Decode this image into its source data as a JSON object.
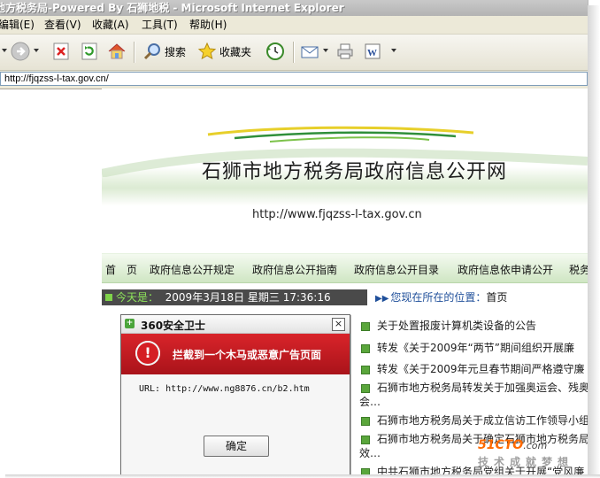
{
  "window": {
    "title": "地方税务局-Powered By 石狮地税 - Microsoft Internet Explorer"
  },
  "menu": {
    "items": [
      "编辑(E)",
      "查看(V)",
      "收藏(A)",
      "工具(T)",
      "帮助(H)"
    ]
  },
  "toolbar": {
    "search_label": "搜索",
    "favorites_label": "收藏夹"
  },
  "address": {
    "url": "http://fjqzss-l-tax.gov.cn/"
  },
  "site": {
    "title": "石狮市地方税务局政府信息公开网",
    "url": "http://www.fjqzss-l-tax.gov.cn"
  },
  "nav": {
    "items": [
      "首　页",
      "政府信息公开规定",
      "政府信息公开指南",
      "政府信息公开目录",
      "政府信息依申请公开",
      "税务"
    ]
  },
  "datebar": {
    "today_label": "今天是：",
    "datetime": "2009年3月18日 星期三 17:36:16",
    "location_label": "您现在所在的位置：",
    "location": "首页"
  },
  "news": {
    "items": [
      "关于处置报废计算机类设备的公告",
      "转发《关于2009年“两节”期间组织开展廉",
      "转发《关于2009年元旦春节期间严格遵守廉",
      "石狮市地方税务局转发关于加强奥运会、残奥",
      "会…",
      "石狮市地方税务局关于成立信访工作领导小组",
      "石狮市地方税务局关于确定石狮市地方税务局",
      "效…",
      "中共石狮市地方税务局党组关于开展“党风廉"
    ]
  },
  "dialog": {
    "title": "360安全卫士",
    "close": "×",
    "message": "拦截到一个木马或恶意广告页面",
    "url": "URL: http://www.ng8876.cn/b2.htm",
    "ok_label": "确定",
    "logo_glyph": "+",
    "warn_glyph": "!"
  },
  "watermark": {
    "line1": "51CTO",
    "line1b": ".com",
    "line2": "技术成就梦想"
  },
  "colors": {
    "dialog_red": "#c8181e",
    "nav_green": "#cfe6c3",
    "date_dark": "#4a4a4a",
    "bullet_green": "#5aa63b"
  },
  "icons": [
    "back-icon",
    "forward-icon",
    "stop-icon",
    "refresh-icon",
    "home-icon",
    "search-icon",
    "favorites-star-icon",
    "history-icon",
    "mail-icon",
    "print-icon",
    "edit-icon",
    "page-icon",
    "warning-icon",
    "shield-icon"
  ]
}
